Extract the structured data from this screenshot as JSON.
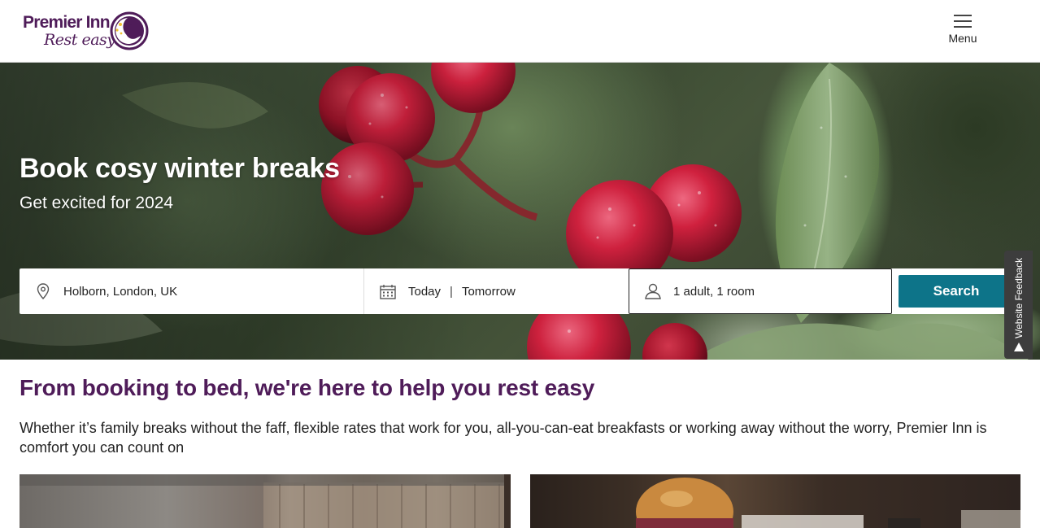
{
  "header": {
    "logo_title": "Premier Inn",
    "logo_tagline": "Rest easy",
    "menu_label": "Menu"
  },
  "hero": {
    "title": "Book cosy winter breaks",
    "subtitle": "Get excited for 2024"
  },
  "search": {
    "location_value": "Holborn, London, UK",
    "checkin": "Today",
    "date_separator": "|",
    "checkout": "Tomorrow",
    "guests_value": "1 adult, 1 room",
    "search_label": "Search"
  },
  "feedback": {
    "label": "Website Feedback"
  },
  "intro": {
    "heading": "From booking to bed, we're here to help you rest easy",
    "body": "Whether it’s family breaks without the faff, flexible rates that work for you, all-you-can-eat breakfasts or working away without the worry, Premier Inn is comfort you can count on"
  },
  "colors": {
    "brand_purple": "#4f1c59",
    "search_button": "#0d7489",
    "feedback_tab": "#3d3d3d"
  },
  "icons": {
    "location": "map-pin-icon",
    "dates": "calendar-icon",
    "guests": "person-icon",
    "menu": "hamburger-icon",
    "feedback": "arrow-up-icon"
  }
}
